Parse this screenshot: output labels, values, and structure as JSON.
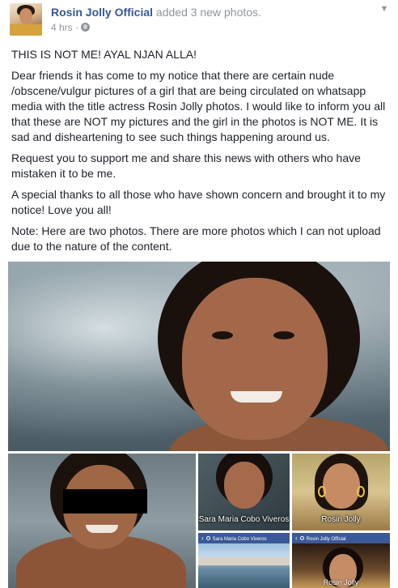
{
  "post": {
    "author": "Rosin Jolly Official",
    "action": "added 3 new photos.",
    "time": "4 hrs",
    "separator": "·",
    "privacy_icon": "globe-icon",
    "menu_icon": "chevron-down-icon",
    "paragraphs": [
      "THIS IS NOT ME! AYAL NJAN ALLA!",
      "Dear friends it has come to my notice that there are certain nude /obscene/vulgur pictures of a girl that are being circulated on whatsapp media with the title actress Rosin Jolly photos. I would like to inform you all that these are NOT my pictures and the girl in the photos is NOT ME. It is sad and disheartening to see such things happening around us.",
      "Request you to support me and share this news with others who have mistaken it to be me.",
      "A special thanks to all those who have shown concern and brought it to my notice! Love you all!",
      "Note: Here are two photos. There are more photos which I can not upload due to the nature of the content."
    ]
  },
  "photos": {
    "caption_left": "Sara Maria Cobo Viveros",
    "caption_right": "Rosin Jolly",
    "bar_left": "Sara Maria Cobo Viveros",
    "bar_right": "Rosin Jolly Official",
    "caption_bottom_right": "Rosin Jolly"
  },
  "colors": {
    "link": "#365899",
    "meta": "#90949c",
    "text": "#1d2129",
    "fb_blue": "#3b5998"
  }
}
